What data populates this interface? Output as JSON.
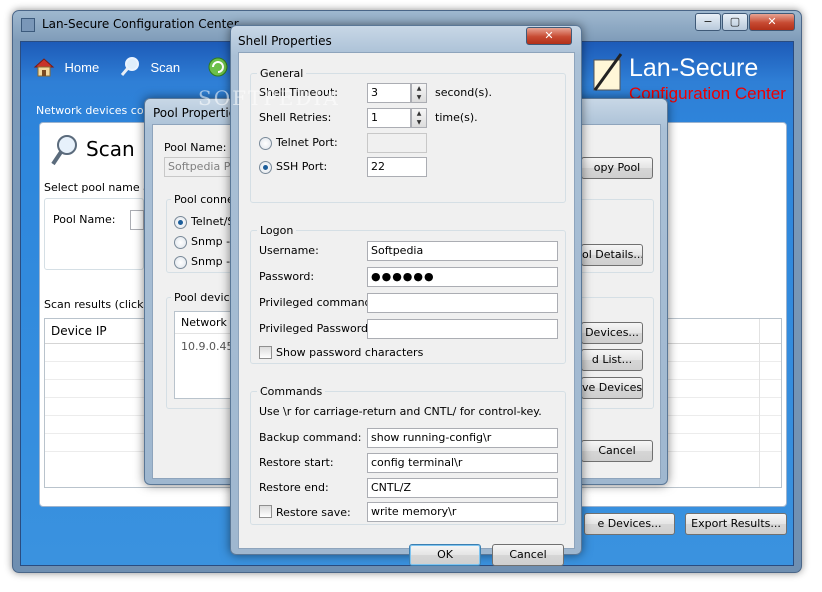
{
  "main_window": {
    "title": "Lan-Secure Configuration Center",
    "caption_buttons": [
      "−",
      "▢",
      "✕"
    ],
    "nav": [
      {
        "label": "Home",
        "icon": "home-icon"
      },
      {
        "label": "Scan",
        "icon": "scan-icon"
      },
      {
        "label": "",
        "icon": "refresh-icon"
      }
    ],
    "brand_line1": "Lan-Secure",
    "brand_line2": "Configuration Center",
    "breadcrumb": "Network devices config",
    "page_title": "Scan",
    "select_pool_text": "Select pool name ar",
    "pool_name_label": "Pool Name:",
    "scan_results_text": "Scan results (click a",
    "grid_header": "Device IP",
    "buttons": {
      "save_devices": "e Devices...",
      "export_results": "Export Results..."
    }
  },
  "pool_dialog": {
    "title": "Pool Properties",
    "pool_name_label": "Pool Name:",
    "pool_name_value": "Softpedia Poo",
    "connection_group": "Pool connec",
    "connection_options": [
      "Telnet/S",
      "Snmp - V",
      "Snmp - V"
    ],
    "devices_group": "Pool devices",
    "devices_header": "Network",
    "devices_rows": [
      "10.9.0.45"
    ],
    "buttons": {
      "copy_pool": "opy Pool",
      "pool_details": "ol Details...",
      "devices": "Devices...",
      "load_list": "d List...",
      "save_devices": "ve Devices",
      "cancel": "Cancel"
    }
  },
  "shell_dialog": {
    "title": "Shell Properties",
    "close_glyph": "✕",
    "general": {
      "label": "General",
      "shell_timeout_label": "Shell Timeout:",
      "shell_timeout_value": "3",
      "timeout_unit": "second(s).",
      "shell_retries_label": "Shell Retries:",
      "shell_retries_value": "1",
      "retries_unit": "time(s).",
      "telnet_port_label": "Telnet Port:",
      "telnet_port_value": "",
      "ssh_port_label": "SSH Port:",
      "ssh_port_value": "22",
      "selected_port": "ssh"
    },
    "logon": {
      "label": "Logon",
      "username_label": "Username:",
      "username_value": "Softpedia",
      "password_label": "Password:",
      "password_value": "●●●●●●",
      "privileged_command_label": "Privileged command:",
      "privileged_command_value": "",
      "privileged_password_label": "Privileged Password:",
      "privileged_password_value": "",
      "show_password_label": "Show password characters",
      "show_password_checked": false
    },
    "commands": {
      "label": "Commands",
      "hint": "Use \\r for carriage-return and CNTL/ for control-key.",
      "backup_label": "Backup command:",
      "backup_value": "show running-config\\r",
      "restore_start_label": "Restore start:",
      "restore_start_value": "config terminal\\r",
      "restore_end_label": "Restore end:",
      "restore_end_value": "CNTL/Z",
      "restore_save_label": "Restore save:",
      "restore_save_value": "write memory\\r",
      "restore_save_checked": false
    },
    "ok_label": "OK",
    "cancel_label": "Cancel"
  },
  "watermark": "SOFTPEDIA",
  "colors": {
    "accent_blue": "#2f7fd6",
    "brand_red": "#e00000",
    "close_red": "#c74a32"
  }
}
